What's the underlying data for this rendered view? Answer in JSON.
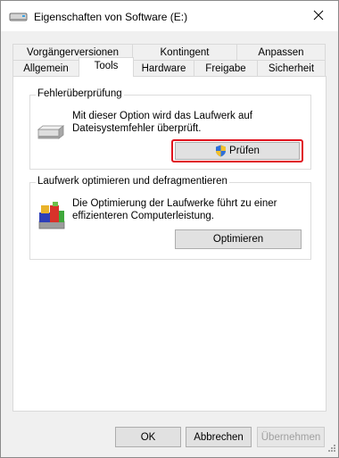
{
  "window": {
    "title": "Eigenschaften von Software (E:)"
  },
  "tabs_row1": [
    {
      "label": "Vorgängerversionen"
    },
    {
      "label": "Kontingent"
    },
    {
      "label": "Anpassen"
    }
  ],
  "tabs_row2": [
    {
      "label": "Allgemein"
    },
    {
      "label": "Tools",
      "active": true
    },
    {
      "label": "Hardware"
    },
    {
      "label": "Freigabe"
    },
    {
      "label": "Sicherheit"
    }
  ],
  "error_check": {
    "legend": "Fehlerüberprüfung",
    "description_line1": "Mit dieser Option wird das Laufwerk auf",
    "description_line2": "Dateisystemfehler überprüft.",
    "button_label": "Prüfen"
  },
  "optimize": {
    "legend": "Laufwerk optimieren und defragmentieren",
    "description_line1": "Die Optimierung der Laufwerke führt zu einer",
    "description_line2": "effizienteren Computerleistung.",
    "button_label": "Optimieren"
  },
  "footer": {
    "ok_label": "OK",
    "cancel_label": "Abbrechen",
    "apply_label": "Übernehmen"
  },
  "colors": {
    "highlight": "#e0141e",
    "window_bg": "#f0f0f0"
  }
}
